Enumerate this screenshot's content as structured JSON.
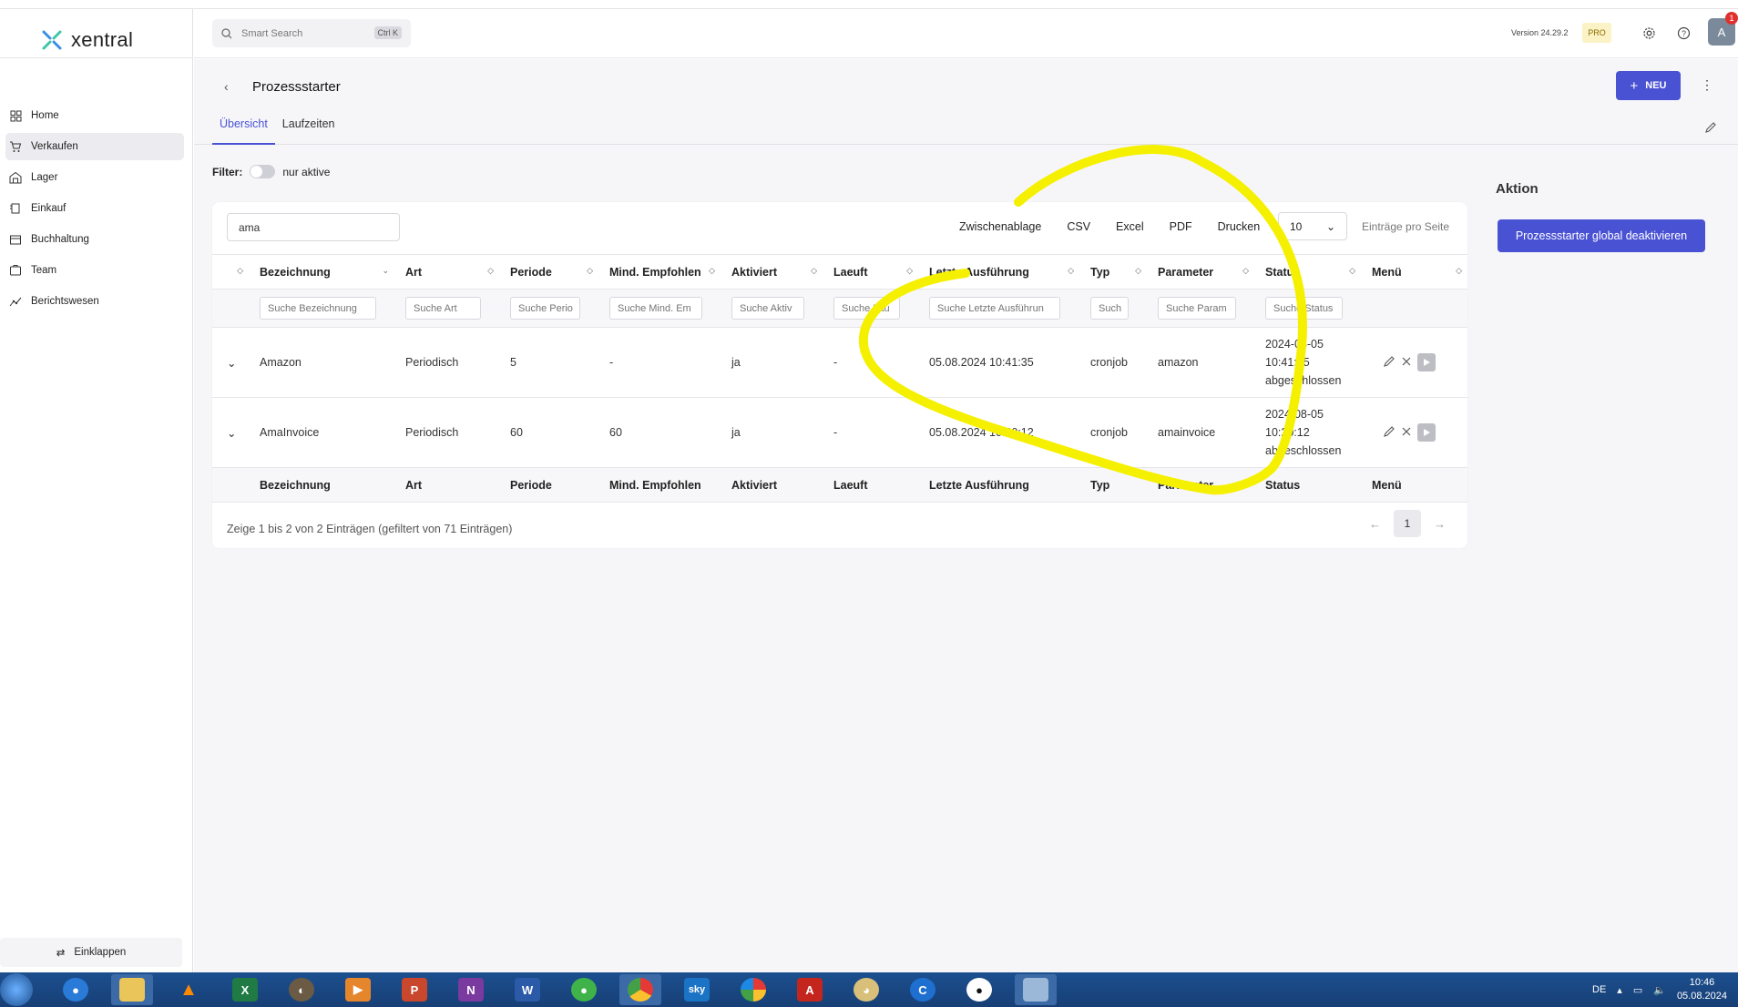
{
  "app": {
    "name": "xentral"
  },
  "header": {
    "search_placeholder": "Smart Search",
    "search_shortcut": "Ctrl K",
    "version": "Version 24.29.2",
    "plan_badge": "PRO",
    "avatar_initial": "A",
    "notification_count": "1"
  },
  "sidebar": {
    "items": [
      {
        "label": "Home",
        "icon": "grid-icon"
      },
      {
        "label": "Verkaufen",
        "icon": "cart-icon"
      },
      {
        "label": "Lager",
        "icon": "warehouse-icon"
      },
      {
        "label": "Einkauf",
        "icon": "purchase-icon"
      },
      {
        "label": "Buchhaltung",
        "icon": "ledger-icon"
      },
      {
        "label": "Team",
        "icon": "team-icon"
      },
      {
        "label": "Berichtswesen",
        "icon": "chart-icon"
      }
    ],
    "collapse_label": "Einklappen"
  },
  "page": {
    "title": "Prozessstarter",
    "new_label": "NEU",
    "tabs": [
      "Übersicht",
      "Laufzeiten"
    ],
    "filter_label": "Filter:",
    "filter_toggle_label": "nur aktive"
  },
  "table": {
    "search_value": "ama",
    "exports": [
      "Zwischenablage",
      "CSV",
      "Excel",
      "PDF",
      "Drucken"
    ],
    "per_page_value": "10",
    "per_page_label": "Einträge pro Seite",
    "columns": [
      "Bezeichnung",
      "Art",
      "Periode",
      "Mind. Empfohlen",
      "Aktiviert",
      "Laeuft",
      "Letzte Ausführung",
      "Typ",
      "Parameter",
      "Status",
      "Menü"
    ],
    "filter_placeholders": [
      "Suche Bezeichnung",
      "Suche Art",
      "Suche Perio",
      "Suche Mind. Em",
      "Suche Aktiv",
      "Suche Lau",
      "Suche Letzte Ausführun",
      "Such",
      "Suche Param",
      "Suche Status"
    ],
    "rows": [
      {
        "bezeichnung": "Amazon",
        "art": "Periodisch",
        "periode": "5",
        "mind": "-",
        "aktiviert": "ja",
        "laeuft": "-",
        "letzte": "05.08.2024 10:41:35",
        "typ": "cronjob",
        "parameter": "amazon",
        "status_date": "2024-08-05",
        "status_time": "10:41:35",
        "status_text": "abgeschlossen"
      },
      {
        "bezeichnung": "AmaInvoice",
        "art": "Periodisch",
        "periode": "60",
        "mind": "60",
        "aktiviert": "ja",
        "laeuft": "-",
        "letzte": "05.08.2024 10:20:12",
        "typ": "cronjob",
        "parameter": "amainvoice",
        "status_date": "2024-08-05",
        "status_time": "10:20:12",
        "status_text": "abgeschlossen"
      }
    ],
    "info": "Zeige 1 bis 2 von 2 Einträgen (gefiltert von 71 Einträgen)",
    "current_page": "1"
  },
  "aktion": {
    "title": "Aktion",
    "button_label": "Prozessstarter global deaktivieren"
  },
  "taskbar": {
    "language": "DE",
    "time": "10:46",
    "date": "05.08.2024"
  },
  "colors": {
    "accent": "#4a52d4",
    "highlight": "#f5f000"
  }
}
